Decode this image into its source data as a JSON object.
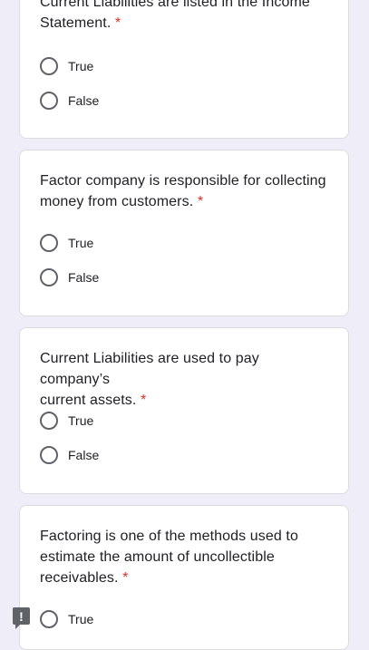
{
  "questions": [
    {
      "text_line1": "Current Liabilities are listed in the Income",
      "text_line2": "Statement.",
      "required": "*",
      "options": [
        "True",
        "False"
      ]
    },
    {
      "text_line1": "Factor company is responsible for collecting",
      "text_line2": "money from customers.",
      "required": "*",
      "options": [
        "True",
        "False"
      ]
    },
    {
      "text_line1": "Current Liabilities are used to pay company’s",
      "text_line2": "current assets.",
      "required": "*",
      "options": [
        "True",
        "False"
      ]
    },
    {
      "text_line1": "Factoring is one of the methods used to",
      "text_line2": "estimate the amount of uncollectible",
      "text_line3": "receivables.",
      "required": "*",
      "options": [
        "True"
      ]
    }
  ],
  "feedback_icon": {
    "glyph": "!",
    "name": "report-feedback-icon"
  }
}
